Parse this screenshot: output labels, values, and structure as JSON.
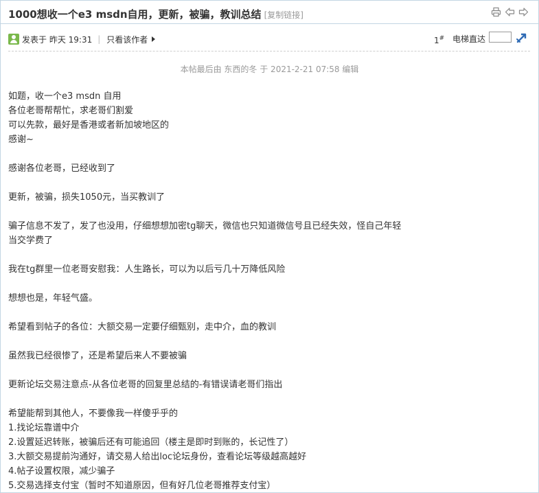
{
  "header": {
    "title": "1000想收一个e3 msdn自用，更新，被骗，教训总结",
    "copy_link": "[复制链接]",
    "icons": [
      "print-icon",
      "prev-thread-icon",
      "next-thread-icon"
    ]
  },
  "post_meta": {
    "posted": "发表于 昨天 19:31",
    "separator": "|",
    "author_only": "只看该作者",
    "floor_number": "1",
    "floor_symbol": "#",
    "jump_label": "电梯直达",
    "jump_input_value": ""
  },
  "edit_note": "本帖最后由 东西的冬 于 2021-2-21 07:58 编辑",
  "content": {
    "l1": "如题，收一个e3 msdn 自用",
    "l2": "各位老哥帮帮忙，求老哥们割爱",
    "l3": "可以先款，最好是香港或者新加坡地区的",
    "l4": "感谢~",
    "l5": "感谢各位老哥，已经收到了",
    "l6": "更新，被骗，损失1050元，当买教训了",
    "l7": "骗子信息不发了，发了也没用，仔细想想加密tg聊天，微信也只知道微信号且已经失效，怪自己年轻",
    "l8": "当交学费了",
    "l9": "我在tg群里一位老哥安慰我：人生路长，可以为以后亏几十万降低风险",
    "l10": "想想也是，年轻气盛。",
    "l11": "希望看到帖子的各位：大额交易一定要仔细甄别，走中介，血的教训",
    "l12": "虽然我已经很惨了，还是希望后来人不要被骗",
    "l13": "更新论坛交易注意点-从各位老哥的回复里总结的-有错误请老哥们指出",
    "l14": "希望能帮到其他人，不要像我一样傻乎乎的",
    "l15": "1.找论坛靠谱中介",
    "l16": "2.设置延迟转账，被骗后还有可能追回（楼主是即时到账的，长记性了）",
    "l17": "3.大额交易提前沟通好，请交易人给出loc论坛身份，查看论坛等级越高越好",
    "l18": "4.帖子设置权限，减少骗子",
    "l19": "5.交易选择支付宝（暂时不知道原因，但有好几位老哥推荐支付宝）"
  },
  "colors": {
    "border": "#c2d5e3",
    "avatar_green": "#7ab84b",
    "jump_arrow_blue": "#2f6bb5",
    "muted_text": "#999999"
  }
}
